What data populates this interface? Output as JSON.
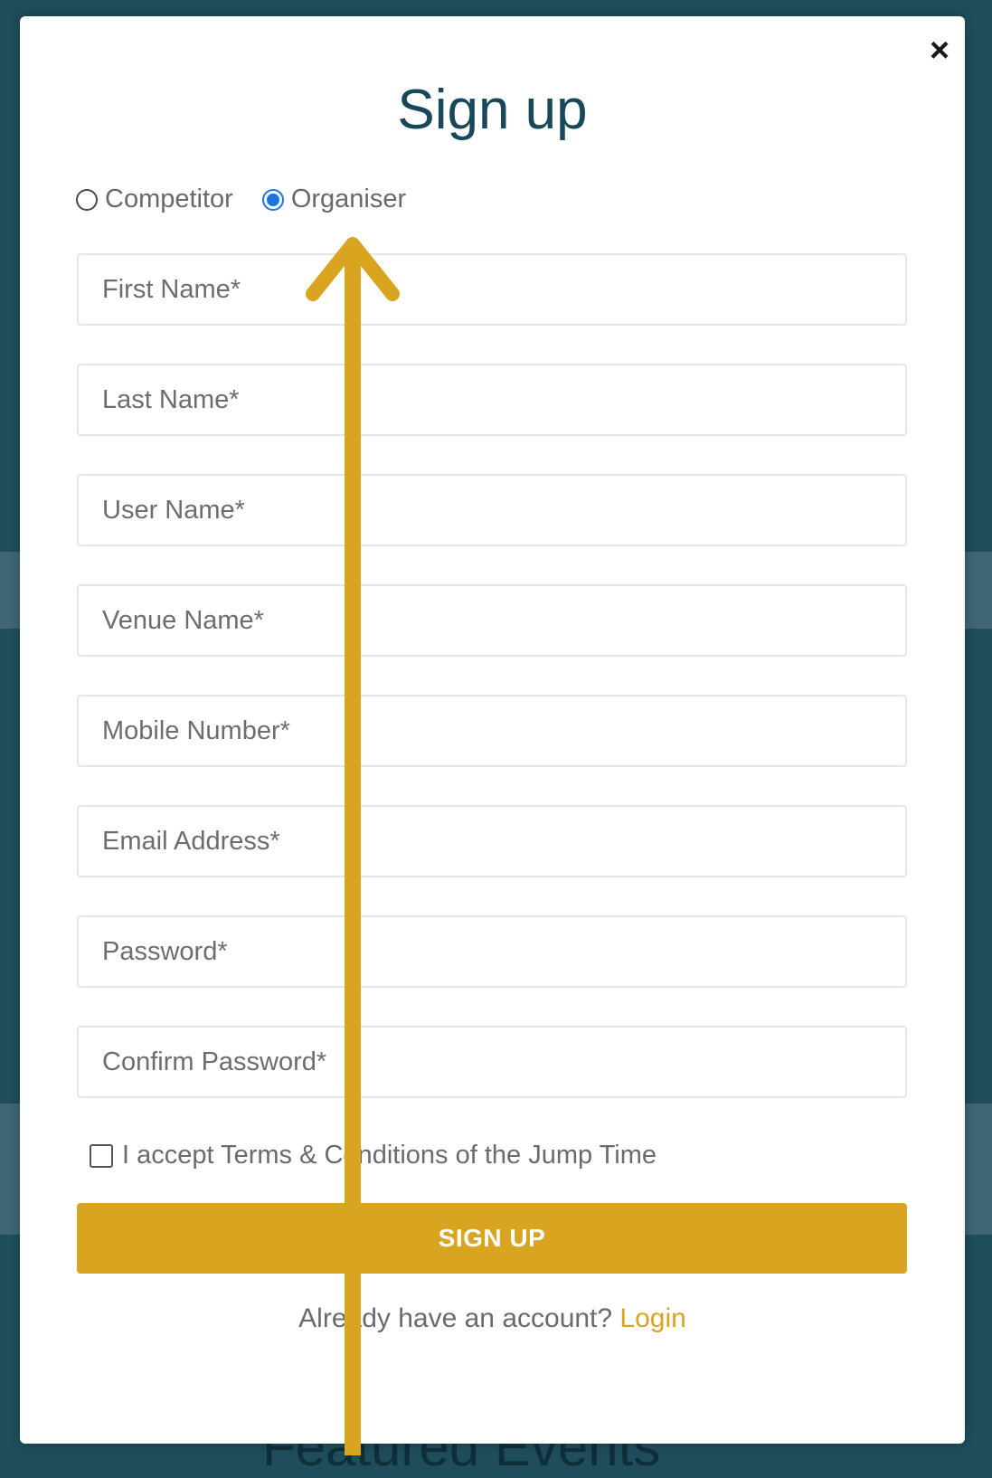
{
  "modal": {
    "title": "Sign up",
    "close_label": "×"
  },
  "roles": {
    "options": [
      {
        "label": "Competitor",
        "selected": false
      },
      {
        "label": "Organiser",
        "selected": true
      }
    ]
  },
  "form": {
    "fields": [
      {
        "placeholder": "First Name*",
        "value": ""
      },
      {
        "placeholder": "Last Name*",
        "value": ""
      },
      {
        "placeholder": "User Name*",
        "value": ""
      },
      {
        "placeholder": "Venue Name*",
        "value": ""
      },
      {
        "placeholder": "Mobile Number*",
        "value": ""
      },
      {
        "placeholder": "Email Address*",
        "value": ""
      },
      {
        "placeholder": "Password*",
        "value": ""
      },
      {
        "placeholder": "Confirm Password*",
        "value": ""
      }
    ],
    "terms_label": "I accept Terms & Conditions of the Jump Time",
    "terms_checked": false,
    "submit_label": "SIGN UP"
  },
  "footer": {
    "prompt": "Already have an account?",
    "login_label": "Login"
  },
  "colors": {
    "accent": "#d9a521",
    "title": "#17495a",
    "radio_selected": "#1a73e8",
    "backdrop": "#1f4d5c"
  },
  "backdrop": {
    "partial_text": "Featured Events"
  },
  "annotation": {
    "type": "arrow",
    "color": "#d9a521",
    "points_to": "Organiser"
  }
}
